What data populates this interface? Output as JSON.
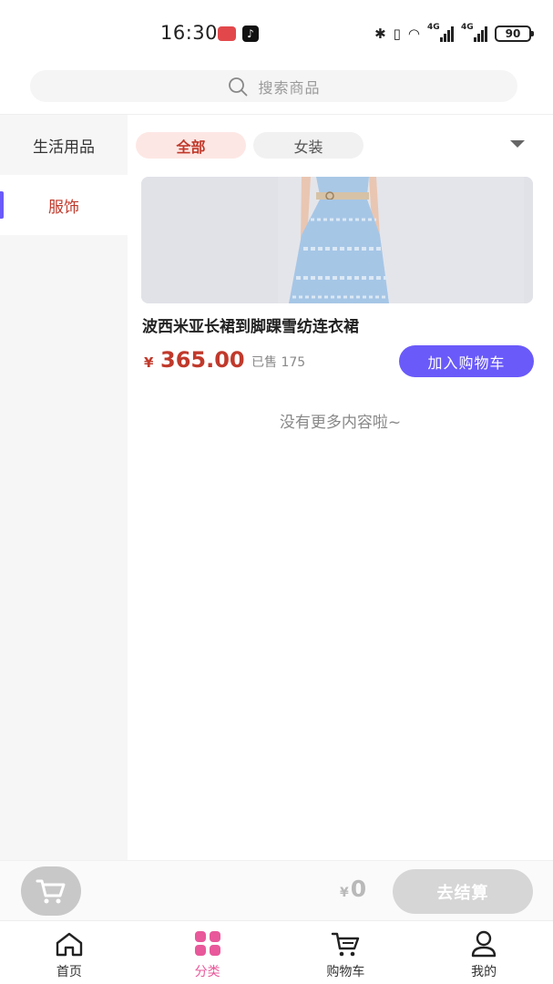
{
  "status_bar": {
    "time": "16:30",
    "tiktok_glyph": "♪",
    "bluetooth_glyph": "✱",
    "vibrate_glyph": "▯",
    "wifi_glyph": "◠",
    "network_1": "4G",
    "network_2": "4G",
    "battery": "90"
  },
  "search": {
    "placeholder": "搜索商品",
    "icon": "search-icon"
  },
  "sidebar": {
    "items": [
      {
        "label": "生活用品",
        "active": false
      },
      {
        "label": "服饰",
        "active": true
      }
    ]
  },
  "tabs": [
    {
      "label": "全部",
      "active": true
    },
    {
      "label": "女装",
      "active": false
    }
  ],
  "product": {
    "title": "波西米亚长裙到脚踝雪纺连衣裙",
    "currency": "¥",
    "price": "365.00",
    "sold": "已售 175",
    "add_cart_label": "加入购物车"
  },
  "no_more": "没有更多内容啦~",
  "checkout": {
    "currency": "¥",
    "total": "0",
    "button_label": "去结算"
  },
  "tabbar": {
    "items": [
      {
        "label": "首页",
        "icon": "home-icon",
        "active": false
      },
      {
        "label": "分类",
        "icon": "category-icon",
        "active": true
      },
      {
        "label": "购物车",
        "icon": "cart-icon",
        "active": false
      },
      {
        "label": "我的",
        "icon": "profile-icon",
        "active": false
      }
    ]
  },
  "colors": {
    "accent_purple": "#6a5af9",
    "price_red": "#c0392b",
    "tab_active_pink": "#e8589a"
  }
}
